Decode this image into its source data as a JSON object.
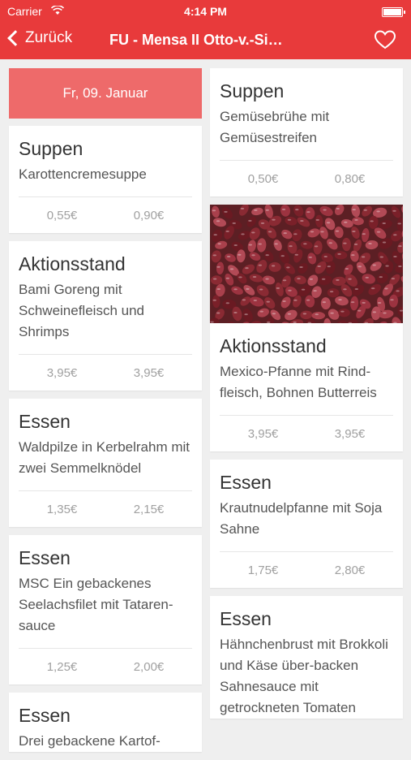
{
  "status_bar": {
    "carrier": "Carrier",
    "time": "4:14 PM"
  },
  "nav": {
    "back_label": "Zurück",
    "title": "FU - Mensa II Otto-v.-Si…"
  },
  "date_banner": "Fr, 09. Januar",
  "left_cards": [
    {
      "category": "Suppen",
      "dish": "Karottencremesuppe",
      "price1": "0,55€",
      "price2": "0,90€"
    },
    {
      "category": "Aktionsstand",
      "dish": "Bami Goreng mit Schweinefleisch und Shrimps",
      "price1": "3,95€",
      "price2": "3,95€"
    },
    {
      "category": "Essen",
      "dish": "Waldpilze in Kerbelrahm mit zwei Semmelknödel",
      "price1": "1,35€",
      "price2": "2,15€"
    },
    {
      "category": "Essen",
      "dish": "MSC Ein gebackenes Seelachsfilet mit Tataren-sauce",
      "price1": "1,25€",
      "price2": "2,00€"
    },
    {
      "category": "Essen",
      "dish": "Drei gebackene Kartof-",
      "price1": "",
      "price2": ""
    }
  ],
  "right_cards": [
    {
      "category": "Suppen",
      "dish": "Gemüsebrühe mit Gemüsestreifen",
      "price1": "0,50€",
      "price2": "0,80€"
    },
    {
      "category": "Aktionsstand",
      "dish": "Mexico-Pfanne mit Rind-fleisch, Bohnen Butterreis",
      "price1": "3,95€",
      "price2": "3,95€",
      "image": "kidney-beans-photo"
    },
    {
      "category": "Essen",
      "dish": "Krautnudelpfanne mit Soja Sahne",
      "price1": "1,75€",
      "price2": "2,80€"
    },
    {
      "category": "Essen",
      "dish": "Hähnchenbrust mit Brokkoli und Käse über-backen Sahnesauce mit getrockneten Tomaten",
      "price1": "",
      "price2": ""
    }
  ],
  "colors": {
    "accent": "#e83a3b",
    "banner": "#ee6a6a",
    "background": "#efefef"
  }
}
